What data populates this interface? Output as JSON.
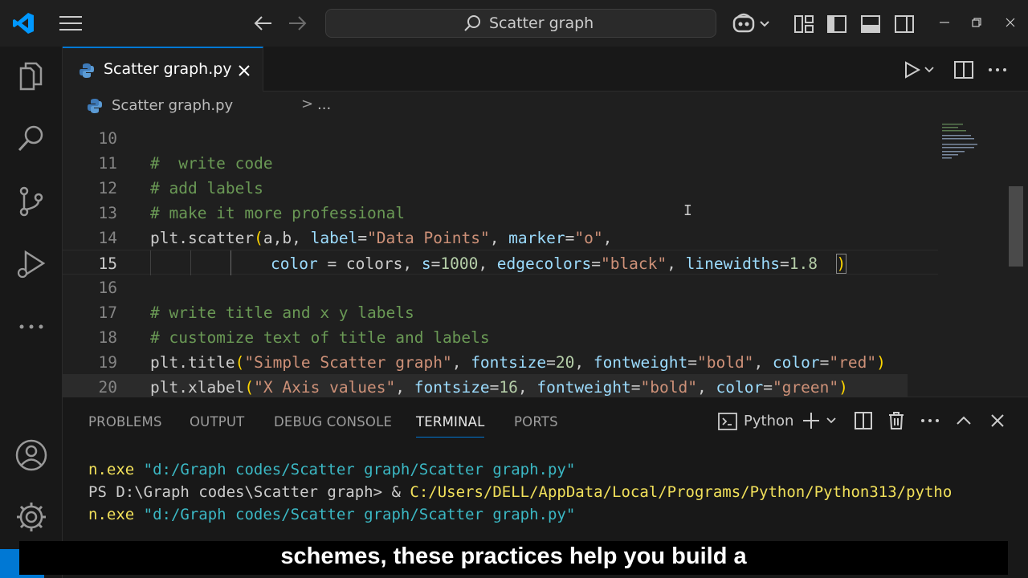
{
  "titlebar": {
    "search_label": "Scatter graph"
  },
  "tab": {
    "label": "Scatter graph.py"
  },
  "breadcrumb": {
    "file": "Scatter graph.py",
    "separator": ">",
    "ellipsis": "..."
  },
  "editor": {
    "lines": [
      {
        "n": "10"
      },
      {
        "n": "11"
      },
      {
        "n": "12"
      },
      {
        "n": "13"
      },
      {
        "n": "14"
      },
      {
        "n": "15"
      },
      {
        "n": "16"
      },
      {
        "n": "17"
      },
      {
        "n": "18"
      },
      {
        "n": "19"
      },
      {
        "n": "20"
      }
    ],
    "code": {
      "l11": "#  write code",
      "l12": "# add labels",
      "l13": "# make it more professional",
      "l14": {
        "a": "plt",
        "b": ".scatter",
        "c": "(",
        "d": "a,b, ",
        "e": "label",
        "f": "=",
        "g": "\"Data Points\"",
        "h": ", ",
        "i": "marker",
        "j": "=",
        "k": "\"o\"",
        "l": ","
      },
      "l15": {
        "a": "color",
        "b": " = colors, ",
        "c": "s",
        "d": "=",
        "e": "1000",
        "f": ", ",
        "g": "edgecolors",
        "h": "=",
        "i": "\"black\"",
        "j": ", ",
        "k": "linewidths",
        "l": "=",
        "m": "1.8",
        "n": "  ",
        "o": ")"
      },
      "l17": "# write title and x y labels",
      "l18": "# customize text of title and labels",
      "l19": {
        "a": "plt.title",
        "b": "(",
        "c": "\"Simple Scatter graph\"",
        "d": ", ",
        "e": "fontsize",
        "f": "=",
        "g": "20",
        "h": ", ",
        "i": "fontweight",
        "j": "=",
        "k": "\"bold\"",
        "l": ", ",
        "m": "color",
        "n": "=",
        "o": "\"red\"",
        "p": ")"
      },
      "l20": {
        "a": "plt.xlabel",
        "b": "(",
        "c": "\"X Axis values\"",
        "d": ", ",
        "e": "fontsize",
        "f": "=",
        "g": "16",
        "h": ", ",
        "i": "fontweight",
        "j": "=",
        "k": "\"bold\"",
        "l": ", ",
        "m": "color",
        "n": "=",
        "o": "\"green\"",
        "p": ")"
      }
    }
  },
  "panel": {
    "tabs": [
      "PROBLEMS",
      "OUTPUT",
      "DEBUG CONSOLE",
      "TERMINAL",
      "PORTS"
    ],
    "terminal_name": "Python",
    "terminal_lines": {
      "l1a": "n.exe ",
      "l1b": "\"d:/Graph codes/Scatter graph/Scatter graph.py\"",
      "l2a": "PS D:\\Graph codes\\Scatter graph> & ",
      "l2b": "C:/Users/DELL/AppData/Local/Programs/Python/Python313/pytho",
      "l3a": "n.exe ",
      "l3b": "\"d:/Graph codes/Scatter graph/Scatter graph.py\""
    }
  },
  "subtitle": {
    "text": "schemes, these practices help you build a"
  },
  "colors": {
    "accent": "#0078d4",
    "bg": "#1f1f1f",
    "comment": "#6a9955",
    "string": "#ce9178"
  }
}
